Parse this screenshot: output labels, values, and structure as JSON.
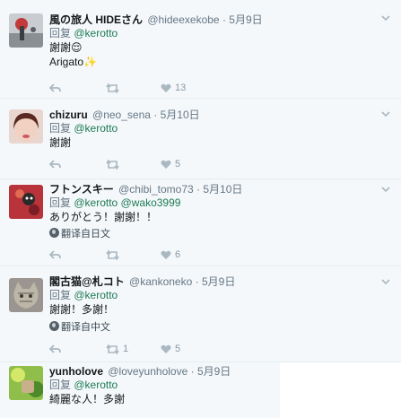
{
  "tweets": [
    {
      "fullname": "風の旅人 HIDEさん",
      "username": "@hideexekobe",
      "separator": "·",
      "time": "5月9日",
      "reply_label": "回复",
      "mentions": "@kerotto",
      "lines": [
        "謝謝😌",
        "Arigato✨"
      ],
      "translate": "",
      "retweets": "",
      "likes": "13"
    },
    {
      "fullname": "chizuru",
      "username": "@neo_sena",
      "separator": "·",
      "time": "5月10日",
      "reply_label": "回复",
      "mentions": "@kerotto",
      "lines": [
        "謝謝"
      ],
      "translate": "",
      "retweets": "",
      "likes": "5"
    },
    {
      "fullname": "フトンスキー",
      "username": "@chibi_tomo73",
      "separator": "·",
      "time": "5月10日",
      "reply_label": "回复",
      "mentions": "@kerotto @wako3999",
      "lines": [
        "ありがとう！謝謝！！"
      ],
      "translate": "翻译自日文",
      "retweets": "",
      "likes": "6"
    },
    {
      "fullname": "閣古猫@札コト",
      "username": "@kankoneko",
      "separator": "·",
      "time": "5月9日",
      "reply_label": "回复",
      "mentions": "@kerotto",
      "lines": [
        "謝謝！多謝！"
      ],
      "translate": "翻译自中文",
      "retweets": "1",
      "likes": "5"
    },
    {
      "fullname": "yunholove",
      "username": "@loveyunholove",
      "separator": "·",
      "time": "5月9日",
      "reply_label": "回复",
      "mentions": "@kerotto",
      "lines": [
        "綺麗な人！多謝"
      ],
      "translate": "",
      "retweets": "",
      "likes": ""
    }
  ],
  "icons": {
    "reply": "reply-arrow-icon",
    "retweet": "retweet-icon",
    "like": "heart-icon",
    "more": "chevron-down-icon",
    "translate": "globe-icon"
  },
  "colors": {
    "background": "#f5f8fa",
    "mention": "#1b7a54",
    "muted": "#657786"
  }
}
